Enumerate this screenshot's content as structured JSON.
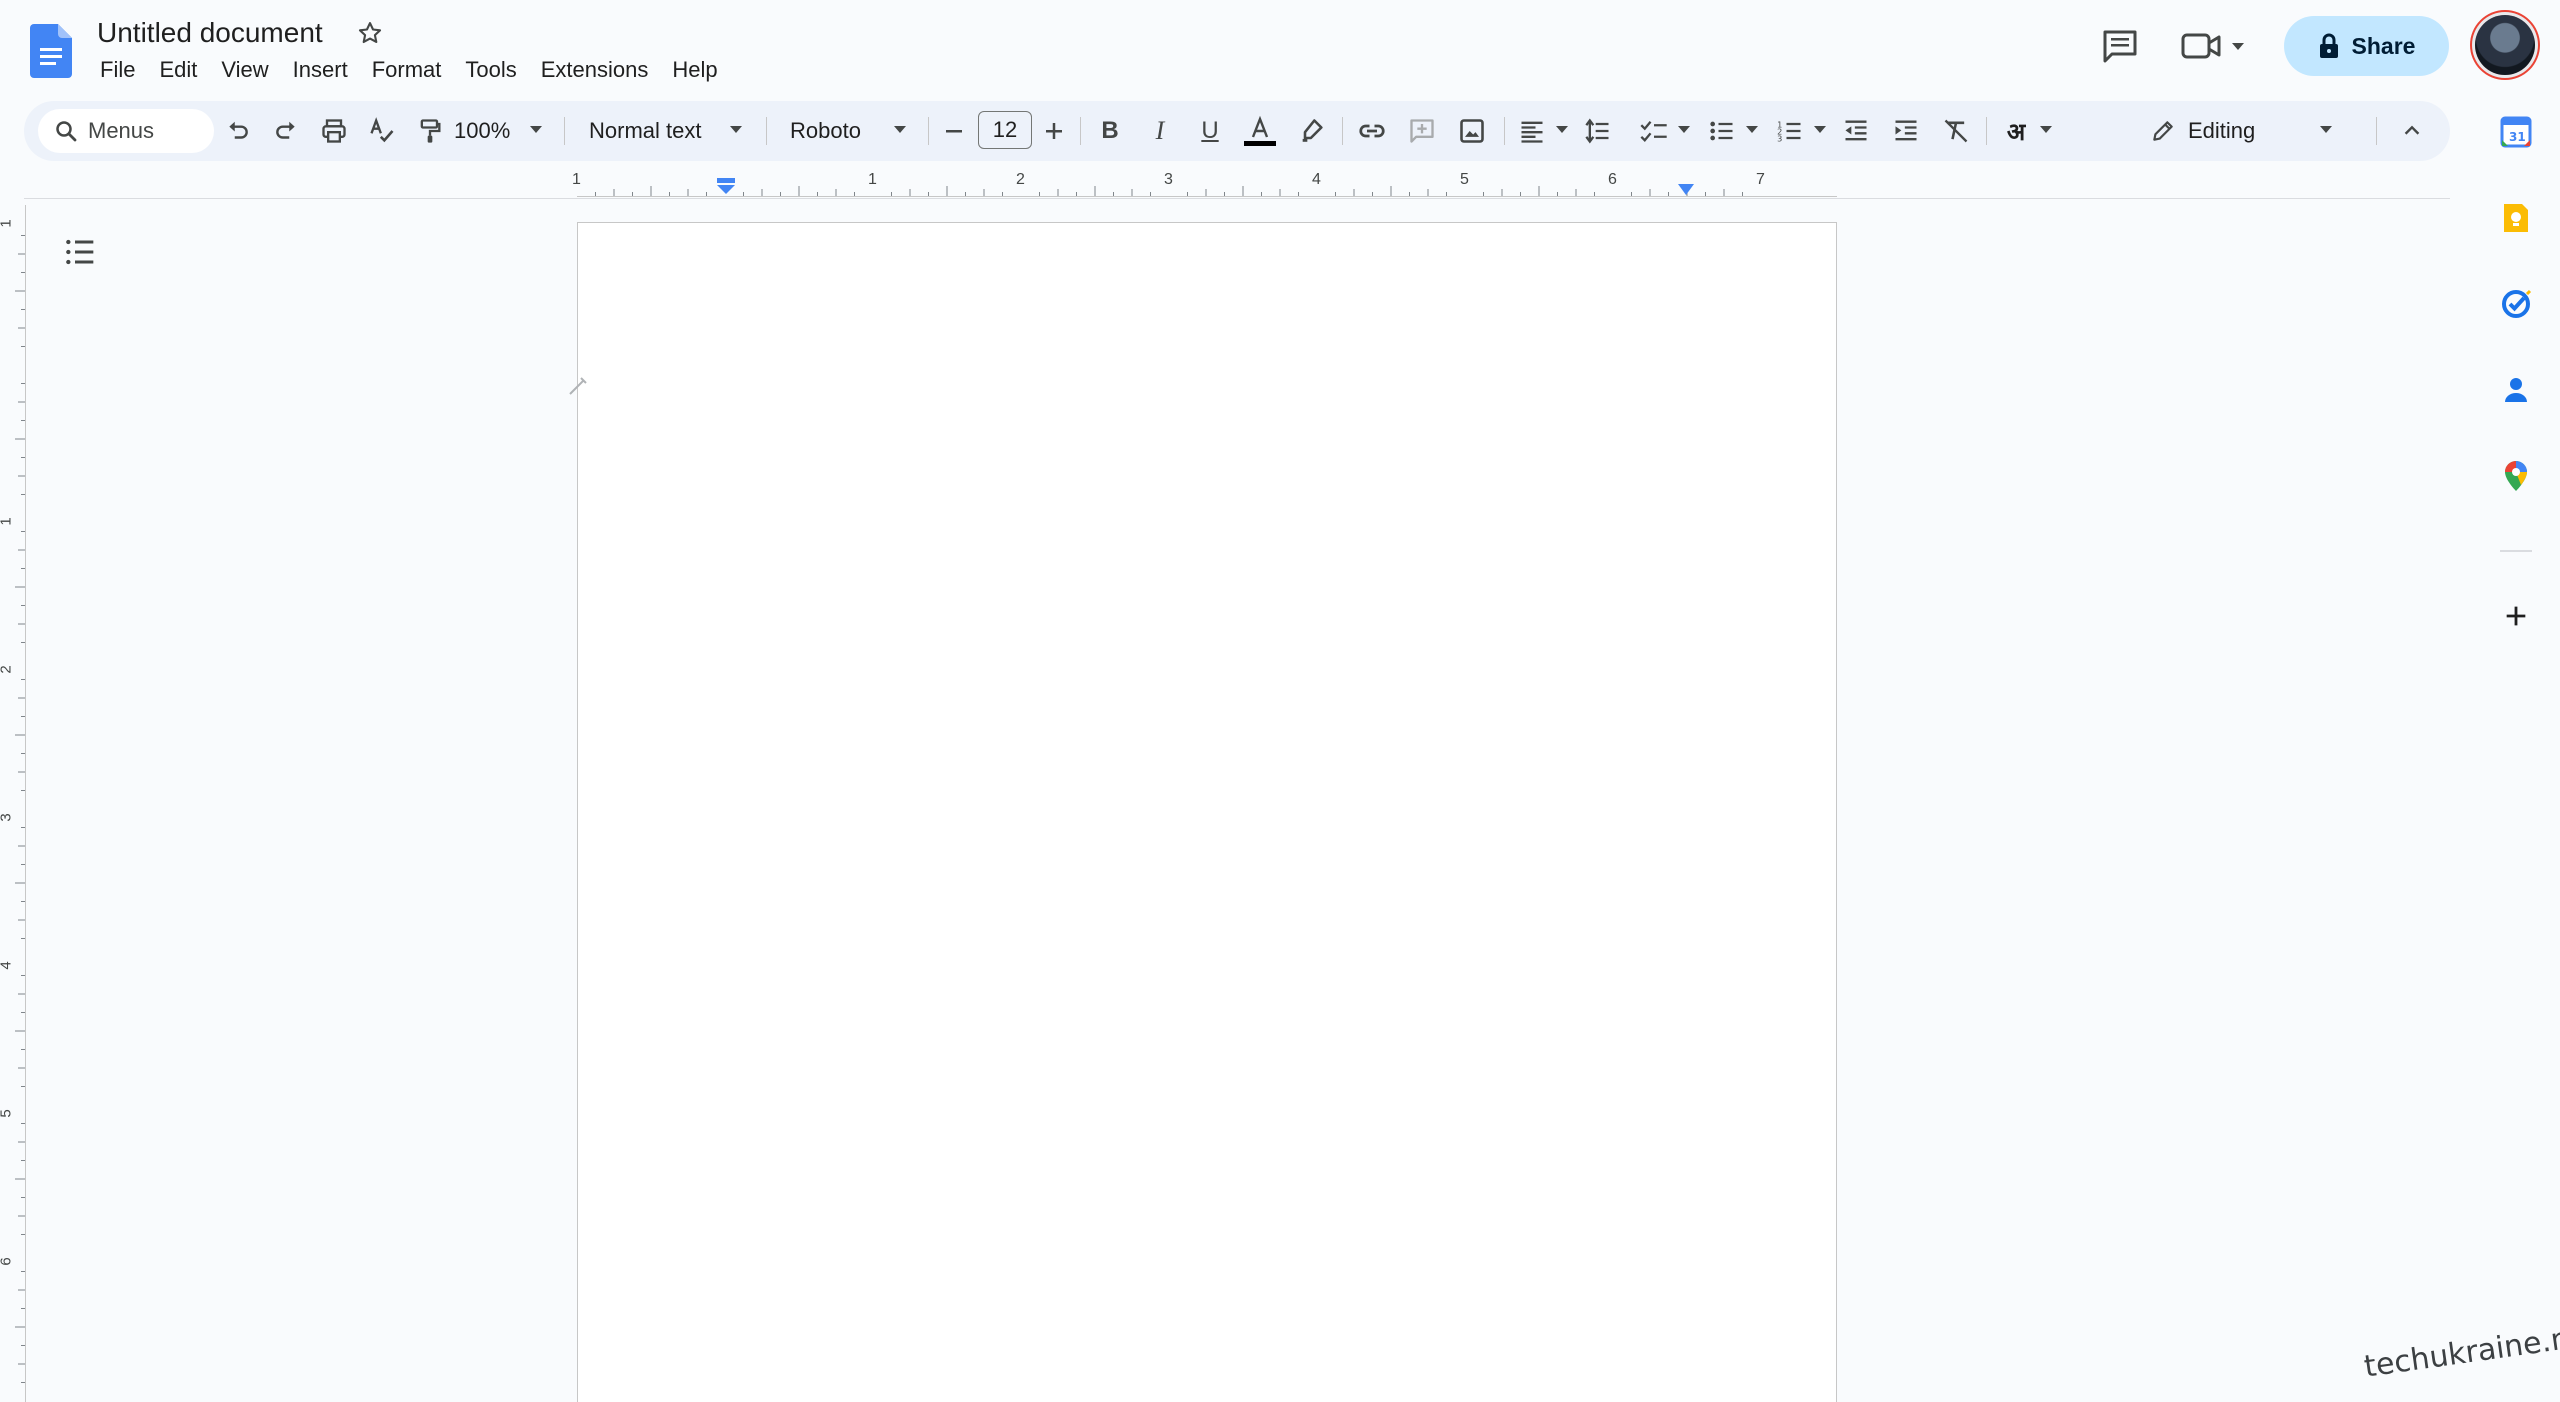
{
  "app": {
    "title": "Untitled document",
    "menus": [
      "File",
      "Edit",
      "View",
      "Insert",
      "Format",
      "Tools",
      "Extensions",
      "Help"
    ],
    "share_label": "Share",
    "accent_color": "#c2e7ff"
  },
  "toolbar": {
    "search_label": "Menus",
    "zoom": "100%",
    "style": "Normal text",
    "font": "Roboto",
    "font_size": "12",
    "language_glyph": "अ",
    "mode": "Editing"
  },
  "ruler": {
    "h_labels": [
      "1",
      "1",
      "2",
      "3",
      "4",
      "5",
      "6",
      "7"
    ],
    "v_labels": [
      "1",
      "1",
      "2",
      "3",
      "4",
      "5",
      "6"
    ]
  },
  "watermark": "techukraine.net",
  "icons": [
    "docs-logo-icon",
    "star-icon",
    "comments-icon",
    "meet-icon",
    "lock-icon",
    "search-icon",
    "undo-icon",
    "redo-icon",
    "print-icon",
    "spellcheck-icon",
    "paint-format-icon",
    "decrease-font-icon",
    "increase-font-icon",
    "text-color-icon",
    "highlight-icon",
    "link-icon",
    "comment-add-icon",
    "image-icon",
    "align-left-icon",
    "line-spacing-icon",
    "checklist-icon",
    "bulleted-list-icon",
    "numbered-list-icon",
    "indent-decrease-icon",
    "indent-increase-icon",
    "clear-format-icon",
    "pencil-icon",
    "collapse-icon",
    "outline-icon",
    "calendar-icon",
    "keep-icon",
    "tasks-icon",
    "contacts-icon",
    "maps-icon",
    "add-icon"
  ]
}
